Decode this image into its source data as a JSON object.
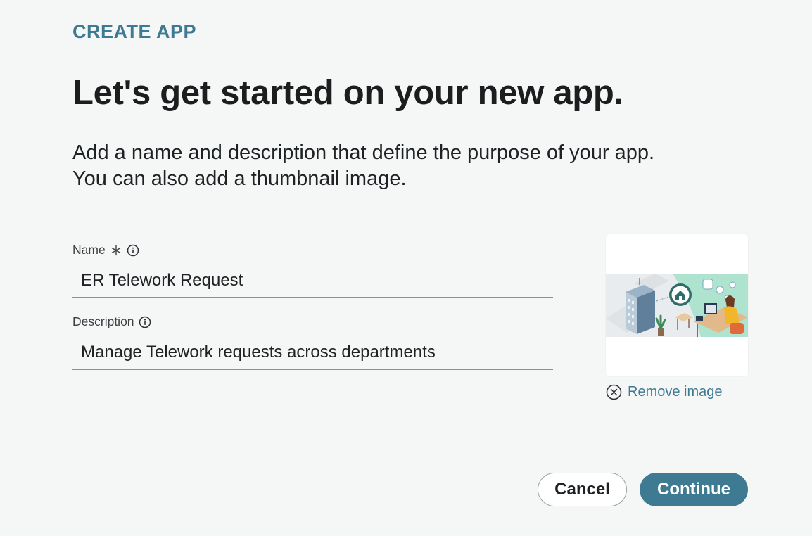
{
  "header": {
    "eyebrow": "CREATE APP",
    "title": "Let's get started on your new app.",
    "intro_line1": "Add a name and description that define the purpose of your app.",
    "intro_line2": "You can also add a thumbnail image."
  },
  "form": {
    "name": {
      "label": "Name",
      "required_icon": "asterisk-icon",
      "info_icon": "info-icon",
      "value": "ER Telework Request"
    },
    "description": {
      "label": "Description",
      "info_icon": "info-icon",
      "value": "Manage Telework requests across departments"
    }
  },
  "thumbnail": {
    "remove_label": "Remove image",
    "remove_icon": "close-circle-icon"
  },
  "actions": {
    "cancel_label": "Cancel",
    "continue_label": "Continue"
  },
  "colors": {
    "accent": "#3f7a93",
    "background": "#f5f6f6",
    "text": "#1f2224"
  }
}
